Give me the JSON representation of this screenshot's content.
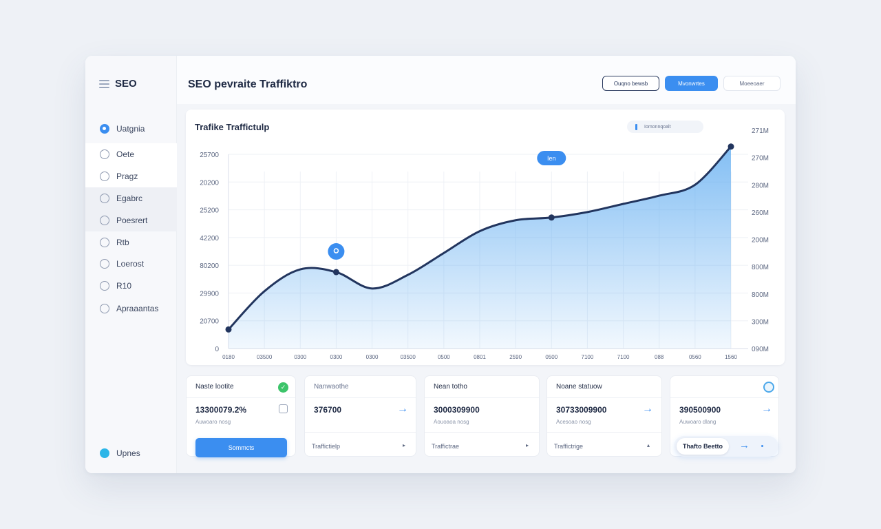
{
  "sidebar": {
    "brand": "SEO",
    "items": [
      {
        "label": "Uatgnia",
        "icon": "target-icon"
      },
      {
        "label": "Oete",
        "icon": "circle-icon"
      },
      {
        "label": "Pragz",
        "icon": "circle-icon"
      },
      {
        "label": "Egabrc",
        "icon": "circle-icon"
      },
      {
        "label": "Poesrert",
        "icon": "circle-icon"
      },
      {
        "label": "Rtb",
        "icon": "circle-icon"
      },
      {
        "label": "Loerost",
        "icon": "circle-icon"
      },
      {
        "label": "R10",
        "icon": "circle-icon"
      },
      {
        "label": "Apraaantas",
        "icon": "circle-icon"
      }
    ],
    "footer_item": {
      "label": "Upnes",
      "icon": "user-icon"
    }
  },
  "header": {
    "title": "SEO pevraite Traffiktro",
    "buttons": [
      "Ouqno bewsb",
      "Mvonwrtes",
      "Moeeoaer"
    ]
  },
  "chart": {
    "title": "Trafike Traffictulp",
    "legend": "Iomonnqoalt",
    "tooltip_label": "Ien",
    "colors": {
      "line": "#22355e",
      "fill": "#5aa9f0",
      "accent": "#3b8ef0"
    }
  },
  "chart_data": {
    "type": "area",
    "title": "Trafike Traffictulp",
    "x": [
      "0180",
      "03500",
      "0300",
      "0300",
      "0300",
      "03500",
      "0500",
      "0801",
      "2590",
      "0500",
      "7100",
      "7100",
      "088",
      "0560",
      "1560"
    ],
    "series": [
      {
        "values": [
          0.7,
          2.1,
          2.9,
          2.8,
          2.2,
          2.7,
          3.5,
          4.3,
          4.7,
          4.8,
          5.0,
          5.3,
          5.6,
          6.0,
          7.4
        ]
      }
    ],
    "y_left_ticks": [
      "25700",
      "20200",
      "25200",
      "42200",
      "80200",
      "29900",
      "20700",
      "0"
    ],
    "y_right_ticks": [
      "271M",
      "270M",
      "280M",
      "260M",
      "200M",
      "800M",
      "800M",
      "300M",
      "090M"
    ],
    "grid": true
  },
  "stats": [
    {
      "title": "Naste lootite",
      "value": "13300079.2%",
      "sub": "Auwoaro nosg",
      "button": "Sommcts"
    },
    {
      "title": "Nanwaothe",
      "value": "376700",
      "sub": "",
      "foot": "Traffictielp"
    },
    {
      "title": "Nean totho",
      "value": "3000309900",
      "sub": "Aouoaoa nosg",
      "foot": "Traffictrae"
    },
    {
      "title": "Noane statuow",
      "value": "30733009900",
      "sub": "Acesoao nosg",
      "foot": "Traffictrige"
    },
    {
      "title": "",
      "value": "390500900",
      "sub": "Auwoaro dlang",
      "pill": "Thafto Beetto"
    }
  ]
}
